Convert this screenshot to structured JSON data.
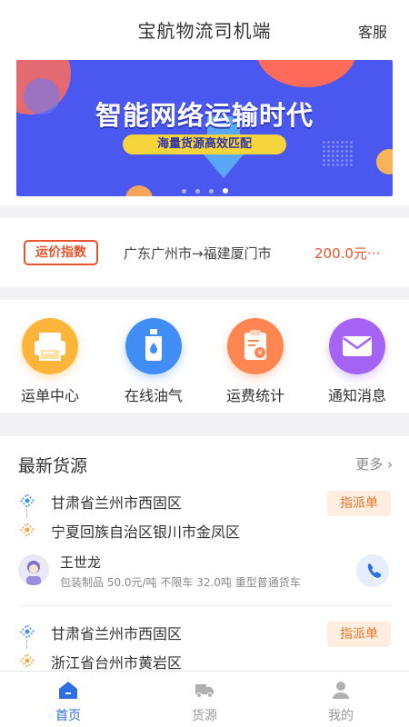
{
  "header": {
    "title": "宝航物流司机端",
    "service_label": "客服"
  },
  "banner": {
    "headline": "智能网络运输时代",
    "tagline": "海量货源高效匹配",
    "slide_count": 4,
    "active_slide": 4
  },
  "freight_index": {
    "logo_text": "运价指数",
    "route": "广东广州市→福建厦门市",
    "price": "200.0元···"
  },
  "menu": [
    {
      "label": "运单中心",
      "icon": "printer-icon",
      "color": "#ffb43a"
    },
    {
      "label": "在线油气",
      "icon": "fuel-bottle-icon",
      "color": "#3f8df5"
    },
    {
      "label": "运费统计",
      "icon": "clipboard-yen-icon",
      "color": "#ff8650"
    },
    {
      "label": "通知消息",
      "icon": "envelope-icon",
      "color": "#a463f2"
    }
  ],
  "cargo": {
    "title": "最新货源",
    "more_label": "更多",
    "items": [
      {
        "origin": "甘肃省兰州市西固区",
        "destination": "宁夏回族自治区银川市金凤区",
        "badge": "指派单",
        "driver": "王世龙",
        "meta": "包装制品 50.0元/吨 不限车 32.0吨 重型普通货车"
      },
      {
        "origin": "甘肃省兰州市西固区",
        "destination": "浙江省台州市黄岩区",
        "badge": "指派单"
      }
    ]
  },
  "tabbar": [
    {
      "label": "首页",
      "icon": "home-icon",
      "active": true
    },
    {
      "label": "货源",
      "icon": "truck-icon",
      "active": false
    },
    {
      "label": "我的",
      "icon": "person-icon",
      "active": false
    }
  ],
  "colors": {
    "accent": "#2f6fe4",
    "price": "#e8542b",
    "badge": "#e8742b"
  }
}
